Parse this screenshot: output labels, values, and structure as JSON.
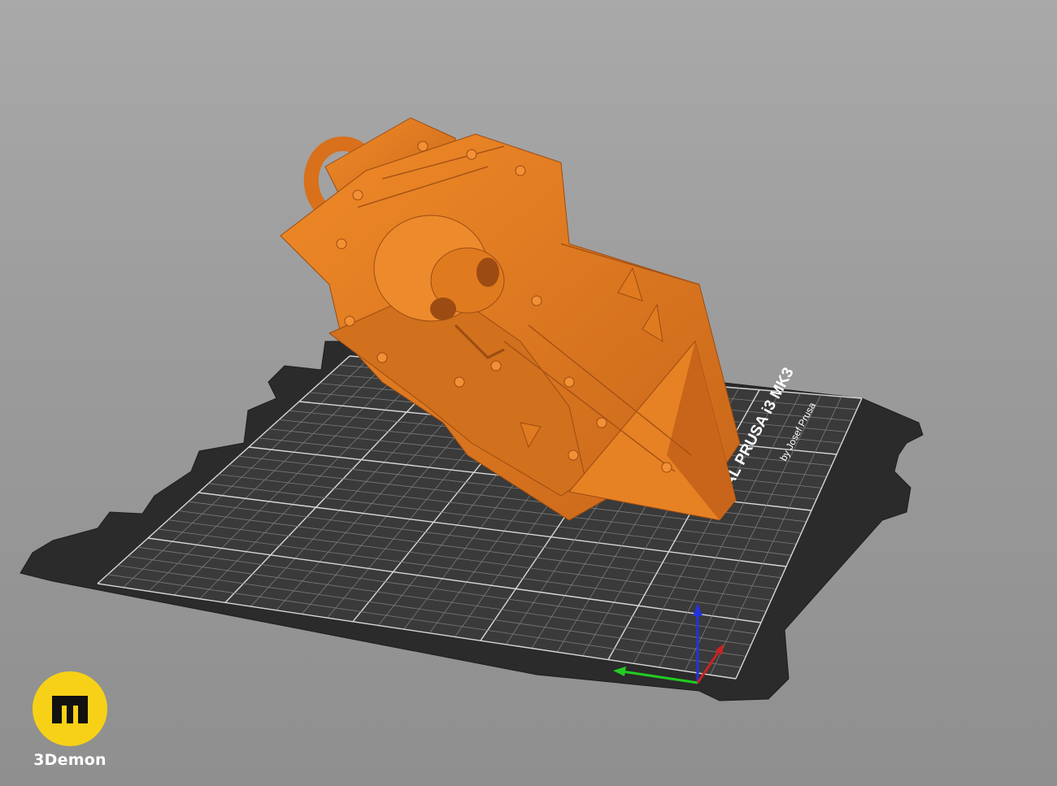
{
  "viewport": {
    "background": "#9b9b9b"
  },
  "bed": {
    "label_line1": "AL PRUSA i3 MK3",
    "label_line2": "by Josef Prusa",
    "sheet_color": "#2b2b2b",
    "grid_color": "#8a8a8a"
  },
  "model": {
    "color": "#e07a1f"
  },
  "axes": {
    "x_color": "#cc2222",
    "y_color": "#22cc22",
    "z_color": "#2233dd"
  },
  "watermark": {
    "brand": "3Demon",
    "glyph": "m",
    "color": "#f7d117"
  }
}
